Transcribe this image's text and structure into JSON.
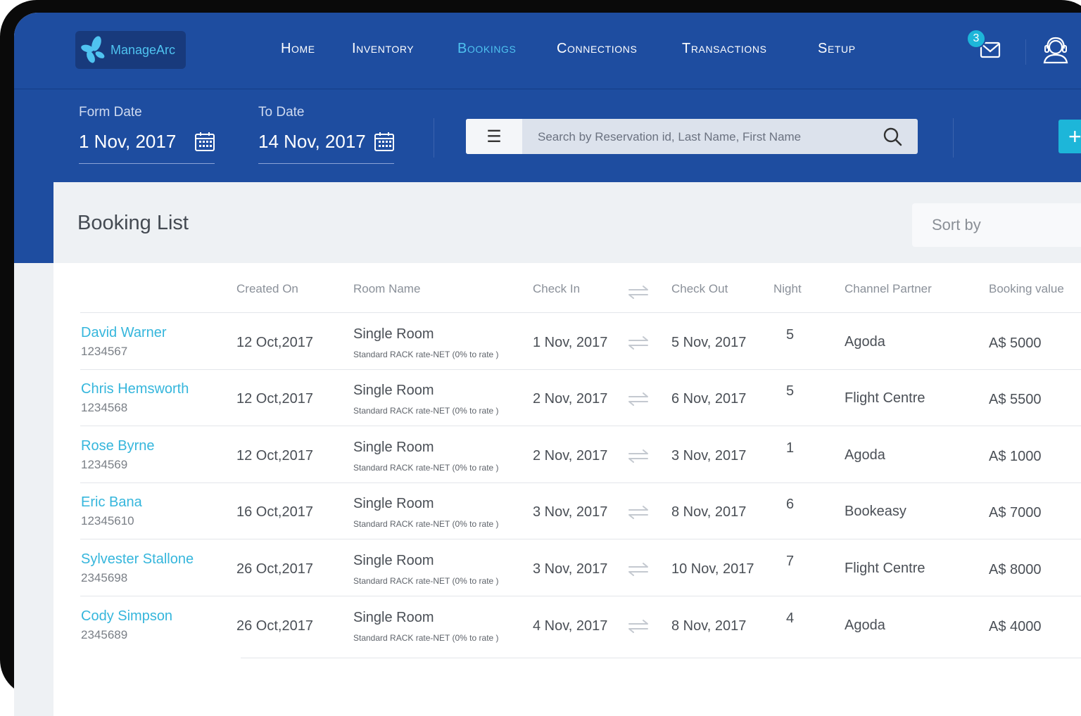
{
  "app": {
    "logo_text": "ManageArc"
  },
  "nav": {
    "items": [
      {
        "label": "Home",
        "active": false
      },
      {
        "label": "Inventory",
        "active": false
      },
      {
        "label": "Bookings",
        "active": true
      },
      {
        "label": "Connections",
        "active": false
      },
      {
        "label": "Transactions",
        "active": false
      },
      {
        "label": "Setup",
        "active": false
      }
    ],
    "notification_count": "3"
  },
  "filters": {
    "from_label": "Form Date",
    "from_value": "1 Nov, 2017",
    "to_label": "To Date",
    "to_value": "14 Nov, 2017",
    "search_placeholder": "Search by Reservation id, Last Name, First Name",
    "add_label": "+"
  },
  "booking_list": {
    "title": "Booking List",
    "sort_label": "Sort by",
    "columns": [
      "Created On",
      "Room Name",
      "Check In",
      "Check Out",
      "Night",
      "Channel Partner",
      "Booking value"
    ],
    "rows": [
      {
        "name": "David Warner",
        "id": "1234567",
        "created": "12 Oct,2017",
        "room": "Single Room",
        "rate": "Standard RACK rate-NET (0% to rate )",
        "check_in": "1 Nov, 2017",
        "check_out": "5 Nov, 2017",
        "nights": "5",
        "partner": "Agoda",
        "value": "A$ 5000"
      },
      {
        "name": "Chris Hemsworth",
        "id": "1234568",
        "created": "12 Oct,2017",
        "room": "Single Room",
        "rate": "Standard RACK rate-NET (0% to rate )",
        "check_in": "2 Nov, 2017",
        "check_out": "6 Nov, 2017",
        "nights": "5",
        "partner": "Flight Centre",
        "value": "A$ 5500"
      },
      {
        "name": "Rose Byrne",
        "id": "1234569",
        "created": "12 Oct,2017",
        "room": "Single Room",
        "rate": "Standard RACK rate-NET (0% to rate )",
        "check_in": "2 Nov, 2017",
        "check_out": "3 Nov, 2017",
        "nights": "1",
        "partner": "Agoda",
        "value": "A$ 1000"
      },
      {
        "name": "Eric Bana",
        "id": "12345610",
        "created": "16 Oct,2017",
        "room": "Single Room",
        "rate": "Standard RACK rate-NET (0% to rate )",
        "check_in": "3 Nov, 2017",
        "check_out": "8 Nov, 2017",
        "nights": "6",
        "partner": "Bookeasy",
        "value": "A$ 7000"
      },
      {
        "name": "Sylvester Stallone",
        "id": "2345698",
        "created": "26 Oct,2017",
        "room": "Single Room",
        "rate": "Standard RACK rate-NET (0% to rate )",
        "check_in": "3 Nov, 2017",
        "check_out": "10 Nov, 2017",
        "nights": "7",
        "partner": "Flight Centre",
        "value": "A$ 8000"
      },
      {
        "name": "Cody Simpson",
        "id": "2345689",
        "created": "26 Oct,2017",
        "room": "Single Room",
        "rate": "Standard RACK rate-NET (0% to rate )",
        "check_in": "4 Nov, 2017",
        "check_out": "8 Nov, 2017",
        "nights": "4",
        "partner": "Agoda",
        "value": "A$ 4000"
      }
    ]
  },
  "colors": {
    "header_bg": "#1e4da0",
    "accent": "#4fc3f0",
    "link": "#35b6dc",
    "button": "#1db6d9"
  },
  "icons": [
    "logo-icon",
    "mail-icon",
    "support-icon",
    "calendar-icon",
    "menu-icon",
    "search-icon",
    "swap-arrows-icon"
  ]
}
